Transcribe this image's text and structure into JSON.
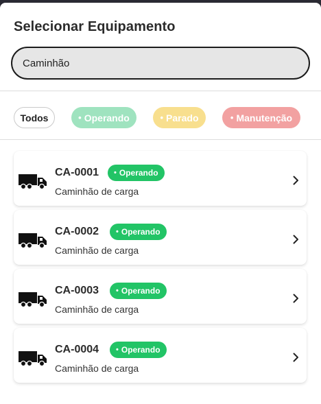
{
  "title": "Selecionar Equipamento",
  "search": {
    "value": "Caminhão",
    "placeholder": ""
  },
  "filters": [
    {
      "label": "Todos"
    },
    {
      "label": "Operando",
      "color": "#9fe3bf"
    },
    {
      "label": "Parado",
      "color": "#f8df8e"
    },
    {
      "label": "Manutenção",
      "color": "#f2a1a1"
    }
  ],
  "status_dot": "•",
  "equipment": [
    {
      "code": "CA-0001",
      "status": "Operando",
      "type": "Caminhão de carga",
      "icon": "truck-icon"
    },
    {
      "code": "CA-0002",
      "status": "Operando",
      "type": "Caminhão de carga",
      "icon": "truck-icon"
    },
    {
      "code": "CA-0003",
      "status": "Operando",
      "type": "Caminhão de carga",
      "icon": "truck-icon"
    },
    {
      "code": "CA-0004",
      "status": "Operando",
      "type": "Caminhão de carga",
      "icon": "truck-icon"
    }
  ],
  "colors": {
    "status_operando": "#22c466",
    "background": "#2a2a33"
  }
}
